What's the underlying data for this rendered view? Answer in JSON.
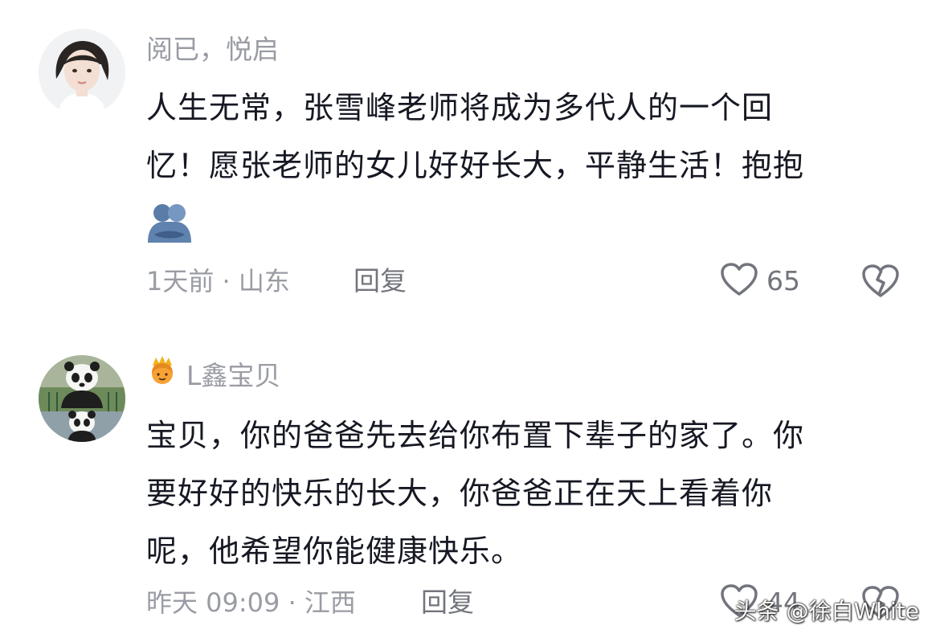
{
  "comments": [
    {
      "username": "阅已，悦启",
      "content_lines": [
        "人生无常，张雪峰老师将成为多代人的一个回",
        "忆！愿张老师的女儿好好长大，平静生活！抱抱"
      ],
      "emoji": "hug-emoji",
      "meta": "1天前 · 山东",
      "reply_label": "回复",
      "like_count": "65"
    },
    {
      "username": "L鑫宝贝",
      "badge": "crown-person-emoji",
      "content_lines": [
        "宝贝，你的爸爸先去给你布置下辈子的家了。你",
        "要好好的快乐的长大，你爸爸正在天上看着你",
        "呢，他希望你能健康快乐。"
      ],
      "meta": "昨天 09:09 · 江西",
      "reply_label": "回复",
      "like_count": "44"
    }
  ],
  "watermark": "头条 @徐白White",
  "colors": {
    "text": "#161823",
    "muted": "#9a9ca4",
    "action": "#73757d",
    "background": "#ffffff"
  }
}
